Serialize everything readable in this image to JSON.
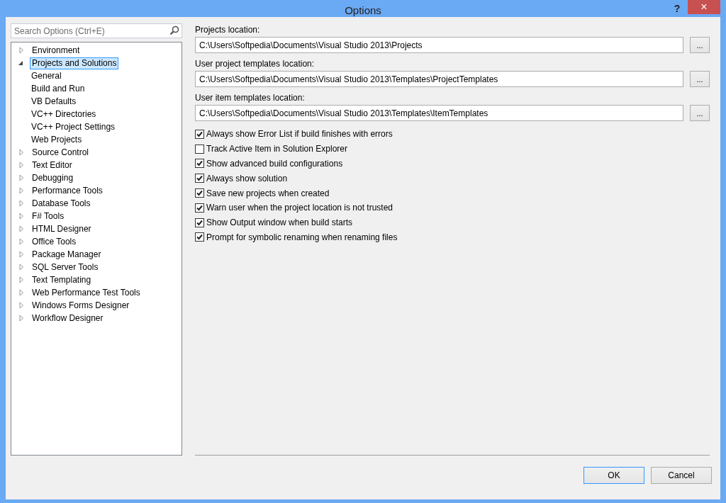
{
  "window": {
    "title": "Options",
    "help": "?",
    "close": "×"
  },
  "search": {
    "placeholder": "Search Options (Ctrl+E)"
  },
  "tree": [
    {
      "label": "Environment",
      "expanded": false,
      "selected": false
    },
    {
      "label": "Projects and Solutions",
      "expanded": true,
      "selected": true,
      "children": [
        {
          "label": "General",
          "selected": false
        },
        {
          "label": "Build and Run",
          "selected": false
        },
        {
          "label": "VB Defaults",
          "selected": false
        },
        {
          "label": "VC++ Directories",
          "selected": false
        },
        {
          "label": "VC++ Project Settings",
          "selected": false
        },
        {
          "label": "Web Projects",
          "selected": false
        }
      ]
    },
    {
      "label": "Source Control",
      "expanded": false,
      "selected": false
    },
    {
      "label": "Text Editor",
      "expanded": false,
      "selected": false
    },
    {
      "label": "Debugging",
      "expanded": false,
      "selected": false
    },
    {
      "label": "Performance Tools",
      "expanded": false,
      "selected": false
    },
    {
      "label": "Database Tools",
      "expanded": false,
      "selected": false
    },
    {
      "label": "F# Tools",
      "expanded": false,
      "selected": false
    },
    {
      "label": "HTML Designer",
      "expanded": false,
      "selected": false
    },
    {
      "label": "Office Tools",
      "expanded": false,
      "selected": false
    },
    {
      "label": "Package Manager",
      "expanded": false,
      "selected": false
    },
    {
      "label": "SQL Server Tools",
      "expanded": false,
      "selected": false
    },
    {
      "label": "Text Templating",
      "expanded": false,
      "selected": false
    },
    {
      "label": "Web Performance Test Tools",
      "expanded": false,
      "selected": false
    },
    {
      "label": "Windows Forms Designer",
      "expanded": false,
      "selected": false
    },
    {
      "label": "Workflow Designer",
      "expanded": false,
      "selected": false
    }
  ],
  "locations": [
    {
      "label": "Projects location:",
      "value": "C:\\Users\\Softpedia\\Documents\\Visual Studio 2013\\Projects",
      "browse": "..."
    },
    {
      "label": "User project templates location:",
      "value": "C:\\Users\\Softpedia\\Documents\\Visual Studio 2013\\Templates\\ProjectTemplates",
      "browse": "..."
    },
    {
      "label": "User item templates location:",
      "value": "C:\\Users\\Softpedia\\Documents\\Visual Studio 2013\\Templates\\ItemTemplates",
      "browse": "..."
    }
  ],
  "options": [
    {
      "label": "Always show Error List if build finishes with errors",
      "checked": true
    },
    {
      "label": "Track Active Item in Solution Explorer",
      "checked": false
    },
    {
      "label": "Show advanced build configurations",
      "checked": true
    },
    {
      "label": "Always show solution",
      "checked": true
    },
    {
      "label": "Save new projects when created",
      "checked": true
    },
    {
      "label": "Warn user when the project location is not trusted",
      "checked": true
    },
    {
      "label": "Show Output window when build starts",
      "checked": true
    },
    {
      "label": "Prompt for symbolic renaming when renaming files",
      "checked": true
    }
  ],
  "buttons": [
    {
      "label": "OK",
      "default": true
    },
    {
      "label": "Cancel",
      "default": false
    }
  ]
}
